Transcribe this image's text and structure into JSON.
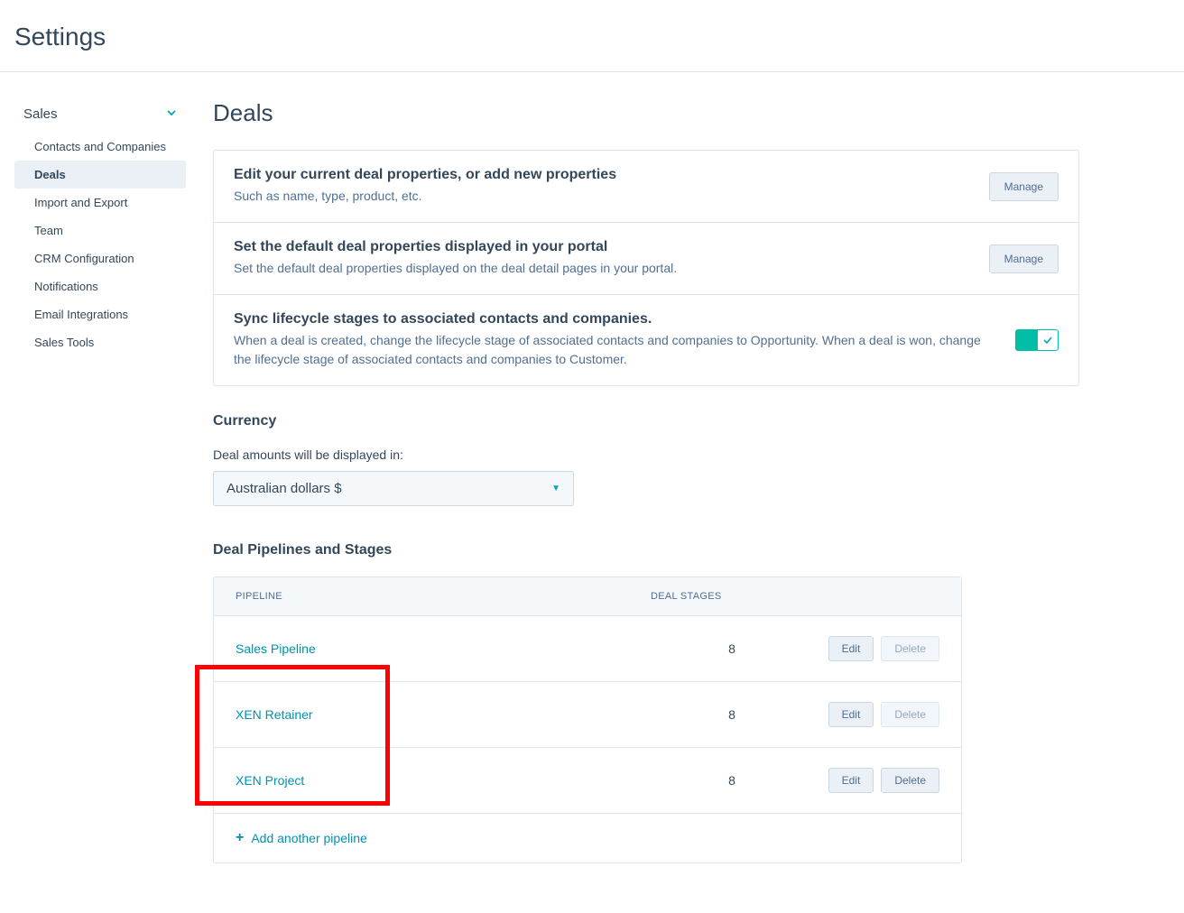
{
  "page_title": "Settings",
  "sidebar": {
    "section_label": "Sales",
    "items": [
      {
        "label": "Contacts and Companies"
      },
      {
        "label": "Deals"
      },
      {
        "label": "Import and Export"
      },
      {
        "label": "Team"
      },
      {
        "label": "CRM Configuration"
      },
      {
        "label": "Notifications"
      },
      {
        "label": "Email Integrations"
      },
      {
        "label": "Sales Tools"
      }
    ]
  },
  "content": {
    "title": "Deals",
    "rows": [
      {
        "title": "Edit your current deal properties, or add new properties",
        "desc": "Such as name, type, product, etc.",
        "action_label": "Manage"
      },
      {
        "title": "Set the default deal properties displayed in your portal",
        "desc": "Set the default deal properties displayed on the deal detail pages in your portal.",
        "action_label": "Manage"
      },
      {
        "title": "Sync lifecycle stages to associated contacts and companies.",
        "desc": "When a deal is created, change the lifecycle stage of associated contacts and companies to Opportunity. When a deal is won, change the lifecycle stage of associated contacts and companies to Customer."
      }
    ],
    "currency": {
      "heading": "Currency",
      "label": "Deal amounts will be displayed in:",
      "selected": "Australian dollars $"
    },
    "pipelines": {
      "heading": "Deal Pipelines and Stages",
      "columns": {
        "pipeline": "PIPELINE",
        "stages": "DEAL STAGES"
      },
      "rows": [
        {
          "name": "Sales Pipeline",
          "stages": "8",
          "edit": "Edit",
          "delete": "Delete",
          "delete_disabled": true
        },
        {
          "name": "XEN Retainer",
          "stages": "8",
          "edit": "Edit",
          "delete": "Delete",
          "delete_disabled": true
        },
        {
          "name": "XEN Project",
          "stages": "8",
          "edit": "Edit",
          "delete": "Delete",
          "delete_disabled": false
        }
      ],
      "add_label": "Add another pipeline"
    }
  }
}
